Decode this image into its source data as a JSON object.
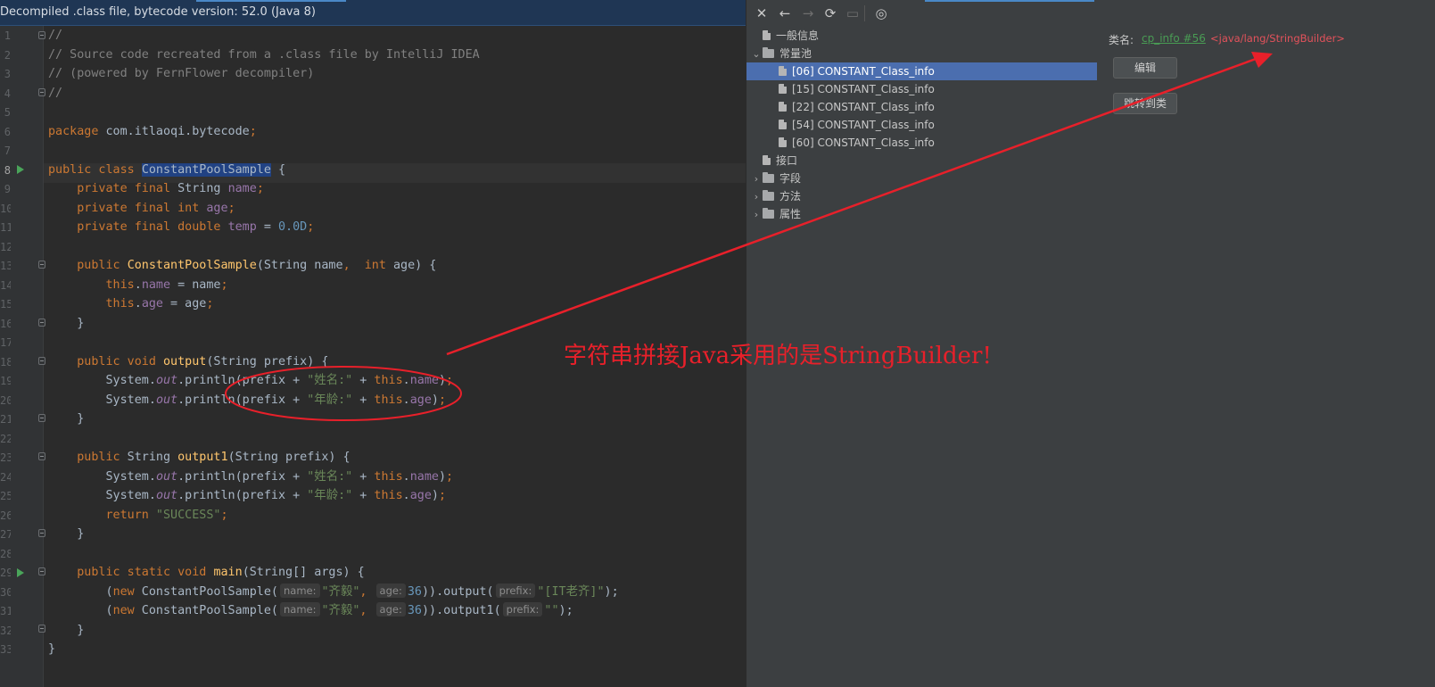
{
  "colors": {
    "editor_bg": "#2b2b2b",
    "panel_bg": "#3c3f41",
    "selection": "#4b6eaf",
    "annotation_red": "#e8202a",
    "keyword": "#cc7832",
    "string": "#6a8759",
    "number": "#6897bb",
    "link_green": "#499c54"
  },
  "editor": {
    "banner": "Decompiled .class file, bytecode version: 52.0 (Java 8)",
    "line_numbers": [
      "1",
      "2",
      "3",
      "4",
      "5",
      "6",
      "7",
      "8",
      "9",
      "10",
      "11",
      "12",
      "13",
      "14",
      "15",
      "16",
      "17",
      "18",
      "19",
      "20",
      "21",
      "22",
      "23",
      "24",
      "25",
      "26",
      "27",
      "28",
      "29",
      "30",
      "31",
      "32",
      "33"
    ],
    "code": {
      "c1": "//",
      "c2": "// Source code recreated from a .class file by IntelliJ IDEA",
      "c3": "// (powered by FernFlower decompiler)",
      "c4": "//",
      "package_kw": "package",
      "package_name": " com.itlaoqi.bytecode",
      "semi": ";",
      "public_kw": "public",
      "class_kw": " class ",
      "class_name": "ConstantPoolSample",
      "brace_open": " {",
      "brace_close": "}",
      "private_final": "private final",
      "string_type": " String ",
      "int_kw": " int",
      "double_kw": " double",
      "f_name": "name",
      "f_age": "age",
      "f_temp": "temp",
      "eq": " = ",
      "zero_d": "0.0D",
      "ctor_name": "ConstantPoolSample",
      "ctor_params_1": "(String name",
      "comma": ", ",
      "ctor_params_2": " age) {",
      "this_kw": "this",
      "dot": ".",
      "assign_name": " = name",
      "assign_age": " = age",
      "void_kw": " void ",
      "output_name": "output",
      "params_prefix": "(String prefix) {",
      "sys": "System.",
      "out": "out",
      "println_open": ".println(prefix + ",
      "str_name_label": "\"姓名:\"",
      "str_age_label": "\"年龄:\"",
      "plus": " + ",
      "close_paren": ")",
      "string_ret": " String ",
      "output1_name": "output1",
      "return_kw": "return",
      "str_success": " \"SUCCESS\"",
      "static_void": " static void ",
      "main_name": "main",
      "main_params": "(String[] args) {",
      "open_paren": "(",
      "new_kw": "new",
      "new_ctor": " ConstantPoolSample(",
      "hint_name": "name:",
      "hint_age": "age:",
      "hint_prefix": "prefix:",
      "str_qi": "\"齐毅\"",
      "num_36": "36",
      "call_output": ")).output(",
      "call_output1": ")).output1(",
      "str_it": "\"[IT老齐]\"",
      "str_empty": "\"\"",
      "end_call": ");"
    }
  },
  "panel": {
    "toolbar": {
      "close": "✕",
      "back": "←",
      "forward": "→",
      "refresh": "⟳",
      "save": "▭",
      "web": "◎"
    },
    "tree": {
      "general": "一般信息",
      "constant_pool": "常量池",
      "cp_items": [
        "[06] CONSTANT_Class_info",
        "[15] CONSTANT_Class_info",
        "[22] CONSTANT_Class_info",
        "[54] CONSTANT_Class_info",
        "[60] CONSTANT_Class_info"
      ],
      "interfaces": "接口",
      "fields": "字段",
      "methods": "方法",
      "attributes": "属性"
    },
    "detail": {
      "label": "类名:",
      "link": "cp_info #56",
      "value": "<java/lang/StringBuilder>",
      "edit_button": "编辑",
      "jump_button": "跳转到类"
    }
  },
  "annotation": {
    "text": "字符串拼接Java采用的是StringBuilder!"
  }
}
